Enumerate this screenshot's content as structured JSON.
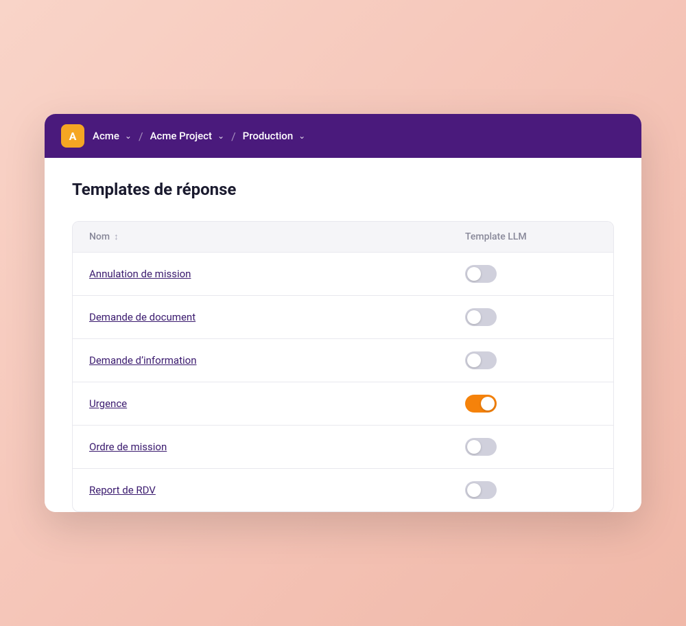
{
  "header": {
    "avatar_letter": "A",
    "breadcrumbs": [
      {
        "id": "acme",
        "label": "Acme"
      },
      {
        "id": "acme-project",
        "label": "Acme Project"
      },
      {
        "id": "production",
        "label": "Production"
      }
    ],
    "separator": "/"
  },
  "page": {
    "title": "Templates de réponse"
  },
  "table": {
    "columns": [
      {
        "id": "nom",
        "label": "Nom",
        "sortable": true
      },
      {
        "id": "template-llm",
        "label": "Template LLM",
        "sortable": false
      }
    ],
    "rows": [
      {
        "id": "annulation",
        "name": "Annulation de mission",
        "toggle": false
      },
      {
        "id": "demande-doc",
        "name": "Demande de document",
        "toggle": false
      },
      {
        "id": "demande-info",
        "name": "Demande d’information",
        "toggle": false
      },
      {
        "id": "urgence",
        "name": "Urgence",
        "toggle": true
      },
      {
        "id": "ordre-mission",
        "name": "Ordre de mission",
        "toggle": false
      },
      {
        "id": "report-rdv",
        "name": "Report de RDV",
        "toggle": false
      }
    ]
  },
  "colors": {
    "header_bg": "#4a1a7c",
    "avatar_bg": "#f5a623",
    "toggle_on": "#f5820a",
    "toggle_off": "#d0d0dc"
  }
}
